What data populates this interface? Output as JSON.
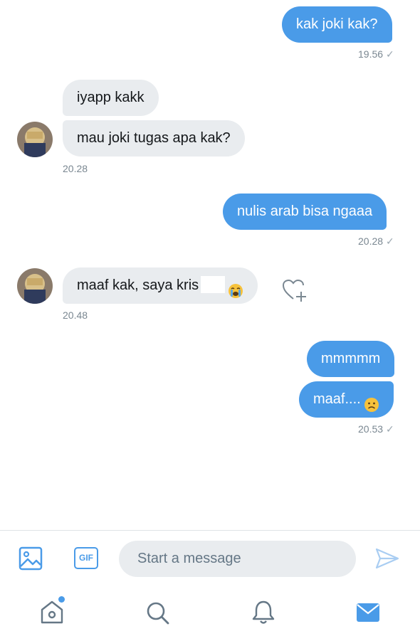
{
  "messages": [
    {
      "dir": "out",
      "text": "kak joki kak?"
    },
    {
      "dir": "in",
      "text": "iyapp kakk"
    },
    {
      "dir": "in",
      "text": "mau joki tugas apa kak?"
    },
    {
      "dir": "out",
      "text": "nulis arab bisa ngaaa"
    },
    {
      "dir": "in",
      "text": "maaf kak, saya kris",
      "emoji": "loudly-crying-face"
    },
    {
      "dir": "out",
      "text": "mmmmm"
    },
    {
      "dir": "out",
      "text": "maaf....",
      "emoji": "frowning-face"
    }
  ],
  "timestamps": {
    "t1": "19.56",
    "t2": "20.28",
    "t3": "20.28",
    "t4": "20.48",
    "t5": "20.53"
  },
  "composer": {
    "placeholder": "Start a message",
    "gif_label": "GIF"
  },
  "nav": {
    "items": [
      "home-icon",
      "search-icon",
      "notifications-icon",
      "messages-icon"
    ],
    "active": "messages-icon",
    "accent": "#4a9be8"
  },
  "colors": {
    "outgoing_bubble": "#4a9be8",
    "incoming_bubble": "#e9ecef",
    "timestamp": "#7a8791"
  }
}
